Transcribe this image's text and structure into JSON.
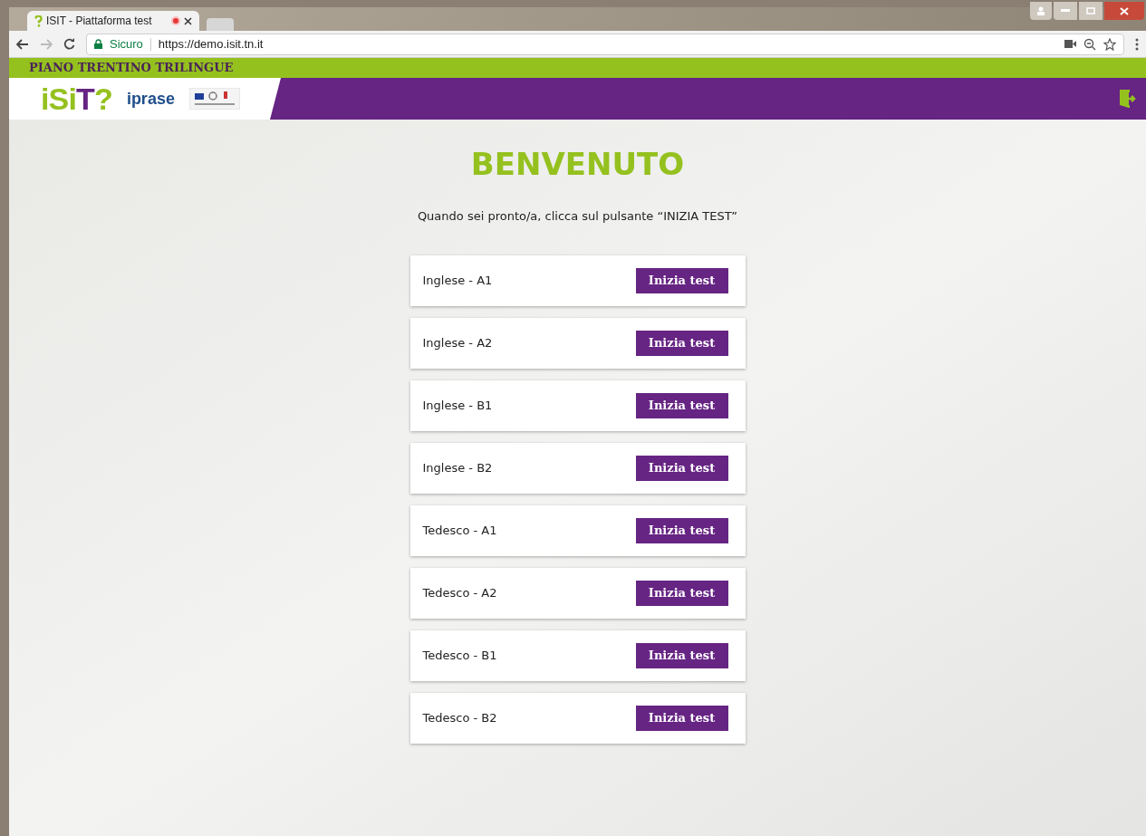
{
  "browser": {
    "tab_title": "ISIT - Piattaforma test",
    "address_security": "Sicuro",
    "address_url": "https://demo.isit.tn.it"
  },
  "site": {
    "banner": "PIANO TRENTINO TRILINGUE",
    "logo": [
      {
        "text": "iSi",
        "color": "#95c11f"
      },
      {
        "text": "T",
        "color": "#662483"
      },
      {
        "text": "?",
        "color": "#95c11f"
      }
    ],
    "partner_logo": "iprase"
  },
  "welcome": {
    "title": "BENVENUTO",
    "instruction": "Quando sei pronto/a, clicca sul pulsante “INIZIA TEST”"
  },
  "tests": [
    {
      "name": "Inglese - A1",
      "button": "Inizia test"
    },
    {
      "name": "Inglese - A2",
      "button": "Inizia test"
    },
    {
      "name": "Inglese - B1",
      "button": "Inizia test"
    },
    {
      "name": "Inglese - B2",
      "button": "Inizia test"
    },
    {
      "name": "Tedesco - A1",
      "button": "Inizia test"
    },
    {
      "name": "Tedesco - A2",
      "button": "Inizia test"
    },
    {
      "name": "Tedesco - B1",
      "button": "Inizia test"
    },
    {
      "name": "Tedesco - B2",
      "button": "Inizia test"
    }
  ]
}
